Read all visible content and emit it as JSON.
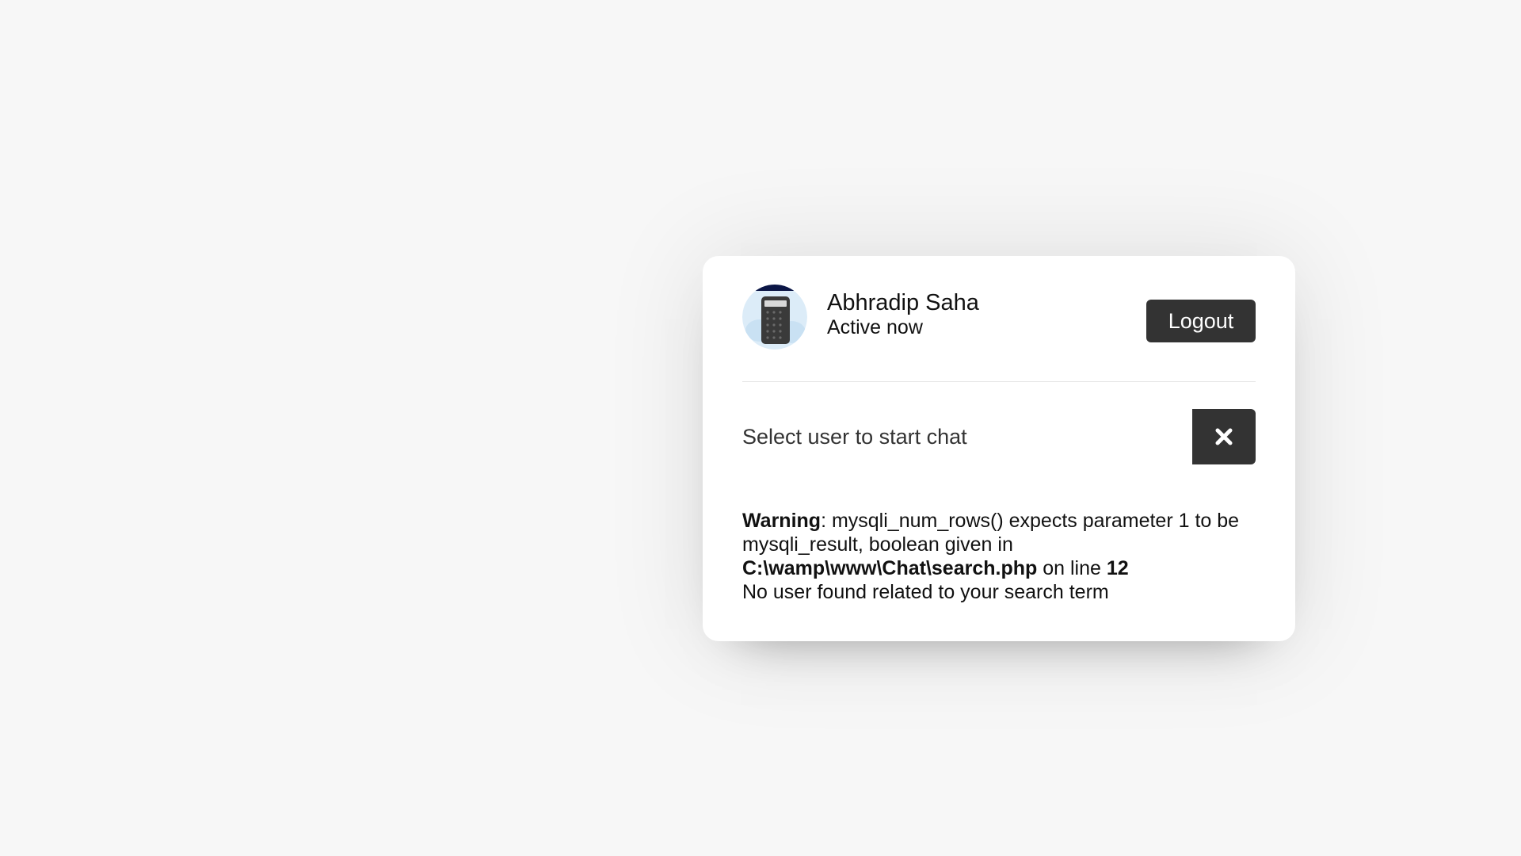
{
  "user": {
    "name": "Abhradip Saha",
    "status": "Active now",
    "avatar_icon": "calculator-avatar-icon"
  },
  "header": {
    "logout_label": "Logout"
  },
  "search": {
    "text": "Select user to start chat",
    "close_icon": "close-icon"
  },
  "results": {
    "warning_label": "Warning",
    "warning_message": ": mysqli_num_rows() expects parameter 1 to be mysqli_result, boolean given in",
    "file_path": "C:\\wamp\\www\\Chat\\search.php",
    "on_line_text": " on line ",
    "line_number": "12",
    "no_user_message": "No user found related to your search term"
  },
  "colors": {
    "background": "#f7f7f7",
    "card": "#ffffff",
    "button": "#333333",
    "text": "#111111"
  }
}
